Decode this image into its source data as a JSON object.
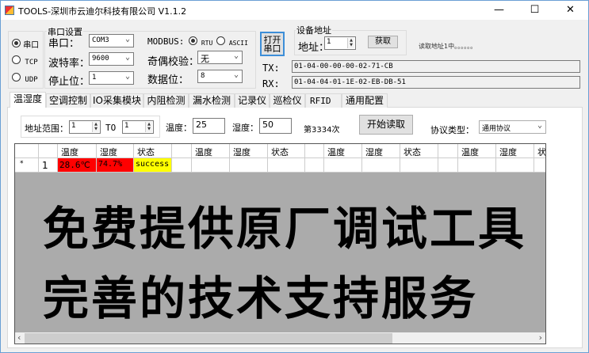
{
  "window": {
    "title": "TOOLS-深圳市云迪尔科技有限公司 V1.1.2",
    "minimize": "—",
    "maximize": "☐",
    "close": "✕"
  },
  "conn": {
    "options": [
      "串口",
      "TCP",
      "UDP"
    ],
    "selected": "串口"
  },
  "serial": {
    "group_title": "串口设置",
    "port_label": "串口：",
    "port": "COM3",
    "baud_label": "波特率：",
    "baud": "9600",
    "stop_label": "停止位：",
    "stop": "1",
    "modbus_label": "MODBUS:",
    "rtu": "RTU",
    "ascii": "ASCII",
    "modbus_selected": "RTU",
    "parity_label": "奇偶校验：",
    "parity": "无",
    "data_label": "数据位：",
    "data_bits": "8"
  },
  "open_button": "打开串口",
  "device": {
    "group_title": "设备地址",
    "addr_label": "地址：",
    "addr": "1",
    "get_button": "获取",
    "status": "读取地址1中。。。。。。"
  },
  "tx": {
    "label": "TX:",
    "value": "01-04-00-00-00-02-71-CB"
  },
  "rx": {
    "label": "RX:",
    "value": "01-04-04-01-1E-02-EB-DB-51"
  },
  "tabs": [
    "温湿度",
    "空调控制",
    "IO采集模块",
    "内阻检测",
    "漏水检测",
    "记录仪",
    "巡检仪",
    "RFID",
    "通用配置"
  ],
  "active_tab": "温湿度",
  "params": {
    "range_label": "地址范围：",
    "from": "1",
    "to_label": "TO",
    "to": "1",
    "temp_label": "温度：",
    "temp": "25",
    "hum_label": "湿度：",
    "hum": "50",
    "count": "第3334次",
    "start_button": "开始读取",
    "protocol_label": "协议类型：",
    "protocol": "通用协议"
  },
  "grid": {
    "headers": [
      "",
      "温度",
      "湿度",
      "状态",
      "",
      "温度",
      "湿度",
      "状态",
      "",
      "温度",
      "湿度",
      "状态",
      "",
      "温度",
      "湿度",
      "状"
    ],
    "row": {
      "marker": "*",
      "index": "1",
      "temp": "28.6℃",
      "hum": "74.7%",
      "status": "success"
    },
    "colors": {
      "alarm": "#ff0000",
      "success": "#ffff00"
    }
  },
  "overlay": {
    "line1": "免费提供原厂调试工具",
    "line2": "完善的技术支持服务"
  },
  "scroll": {
    "left": "‹",
    "right": "›",
    "position": 0.72
  }
}
